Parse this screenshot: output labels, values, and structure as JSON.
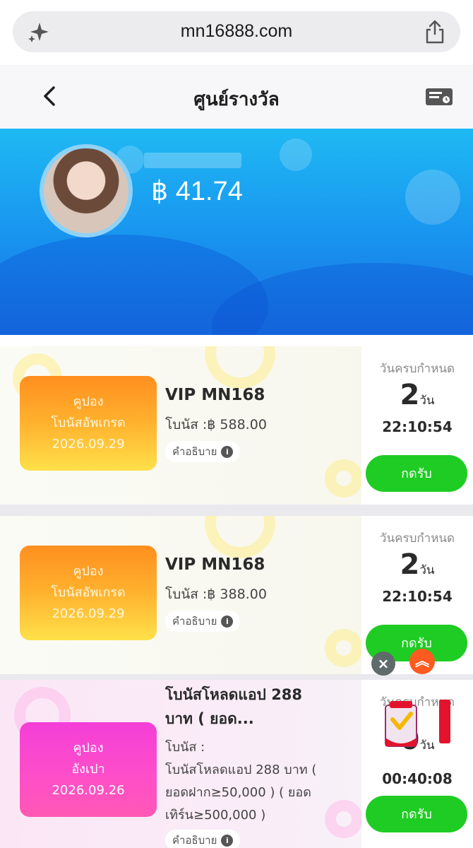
{
  "browser": {
    "url": "mn16888.com"
  },
  "header": {
    "title": "ศูนย์รางวัล"
  },
  "profile": {
    "balance": "฿ 41.74"
  },
  "coupons": [
    {
      "coupon_line1": "คูปอง",
      "coupon_line2": "โบนัสอัพเกรด",
      "coupon_date": "2026.09.29",
      "title": "VIP MN168",
      "bonus": "โบนัส :฿ 588.00",
      "explain": "คำอธิบาย",
      "due_label": "วันครบกำหนด",
      "days": "2",
      "days_unit": "วัน",
      "time": "22:10:54",
      "claim": "กดรับ"
    },
    {
      "coupon_line1": "คูปอง",
      "coupon_line2": "โบนัสอัพเกรด",
      "coupon_date": "2026.09.29",
      "title": "VIP MN168",
      "bonus": "โบนัส :฿ 388.00",
      "explain": "คำอธิบาย",
      "due_label": "วันครบกำหนด",
      "days": "2",
      "days_unit": "วัน",
      "time": "22:10:54",
      "claim": "กดรับ"
    },
    {
      "coupon_line1": "คูปอง",
      "coupon_line2": "อังเปา",
      "coupon_date": "2026.09.26",
      "title_line1": "โบนัสโหลดแอป 288",
      "title_line2": "บาท ( ยอด...",
      "bonus_line1": "โบนัส :",
      "bonus_line2": "โบนัสโหลดแอป 288 บาท (",
      "bonus_line3": "ยอดฝาก≥50,000 ) ( ยอด",
      "bonus_line4": "เทิร์น≥500,000 )",
      "explain": "คำอธิบาย",
      "due_label": "วันครบกำหนด",
      "days": "0",
      "days_unit": "วัน",
      "time": "00:40:08",
      "claim": "กดรับ"
    }
  ],
  "colors": {
    "accent_green": "#1fcc24",
    "hero_blue": "#1892ef",
    "coupon_orange": "#ff8f1f",
    "coupon_pink": "#f43ed8"
  },
  "icons": [
    "sparkle-icon",
    "share-icon",
    "back-icon",
    "ticket-icon",
    "info-icon",
    "close-icon",
    "scroll-up-icon",
    "promo-badge-icon"
  ]
}
